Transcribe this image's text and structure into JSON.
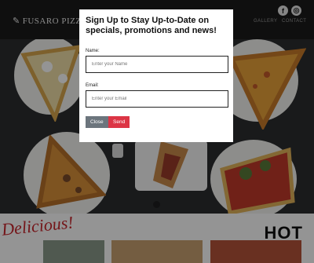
{
  "brand": {
    "name": "FUSARO PIZZA"
  },
  "nav": {
    "items": [
      "GALLERY",
      "CONTACT"
    ]
  },
  "social": {
    "facebook": "f",
    "instagram": "◎"
  },
  "bottom": {
    "banner_left": "Delicious!",
    "banner_right": "HOT"
  },
  "modal": {
    "title": "Sign Up to Stay Up-to-Date on specials, promotions and news!",
    "name_label": "Name:",
    "name_placeholder": "Enter your Name",
    "email_label": "Email:",
    "email_placeholder": "Enter your Email",
    "close_label": "Close",
    "send_label": "Send"
  },
  "colors": {
    "send": "#dc3545",
    "close": "#6c757d",
    "accent_red": "#c9252c"
  }
}
